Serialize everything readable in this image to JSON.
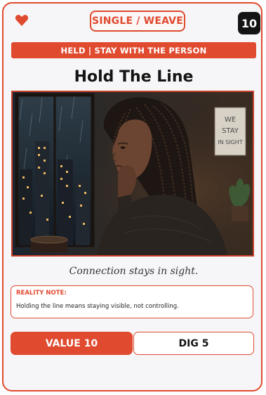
{
  "card": {
    "suit_icon": "heart-icon",
    "type_label": "SINGLE / WEAVE",
    "cost": "10",
    "subtitle": "HELD | STAY WITH THE PERSON",
    "title": "Hold The Line",
    "art": {
      "sign_text_lines": [
        "WE",
        "STAY",
        "IN SIGHT"
      ]
    },
    "caption": "Connection stays in sight.",
    "reality_note": {
      "label": "REALITY NOTE:",
      "text": "Holding the line means staying visible, not controlling."
    },
    "stats": {
      "value_label": "VALUE 10",
      "dig_label": "DIG 5"
    }
  },
  "colors": {
    "accent": "#e04a2f",
    "dark": "#141414",
    "background": "#f6f6f8"
  }
}
